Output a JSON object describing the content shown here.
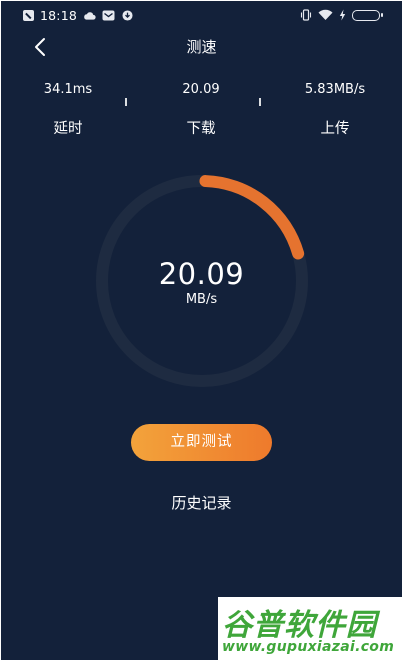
{
  "status_bar": {
    "time": "18:18"
  },
  "header": {
    "title": "测速"
  },
  "stats": {
    "latency": {
      "value": "34.1ms",
      "label": "延时"
    },
    "download": {
      "value": "20.09",
      "label": "下载"
    },
    "upload": {
      "value": "5.83MB/s",
      "label": "上传"
    }
  },
  "gauge": {
    "value": "20.09",
    "unit": "MB/s",
    "progress": 0.2,
    "track_color": "#1e2b41",
    "progress_color": "#e5732f"
  },
  "actions": {
    "start_label": "立即测试",
    "history_label": "历史记录"
  },
  "watermark": {
    "logo": "谷普软件园",
    "url": "www.gupuxiazai.com"
  },
  "colors": {
    "background": "#13213a",
    "accent": "#ee7a2c",
    "watermark_green": "#3fa63a"
  },
  "icons": {
    "back": "chevron-left-icon",
    "status_left": [
      "notification-box-icon",
      "cloud-icon",
      "mail-icon",
      "download-icon"
    ],
    "status_right": [
      "vibrate-icon",
      "wifi-icon",
      "charging-icon",
      "battery-icon"
    ]
  }
}
